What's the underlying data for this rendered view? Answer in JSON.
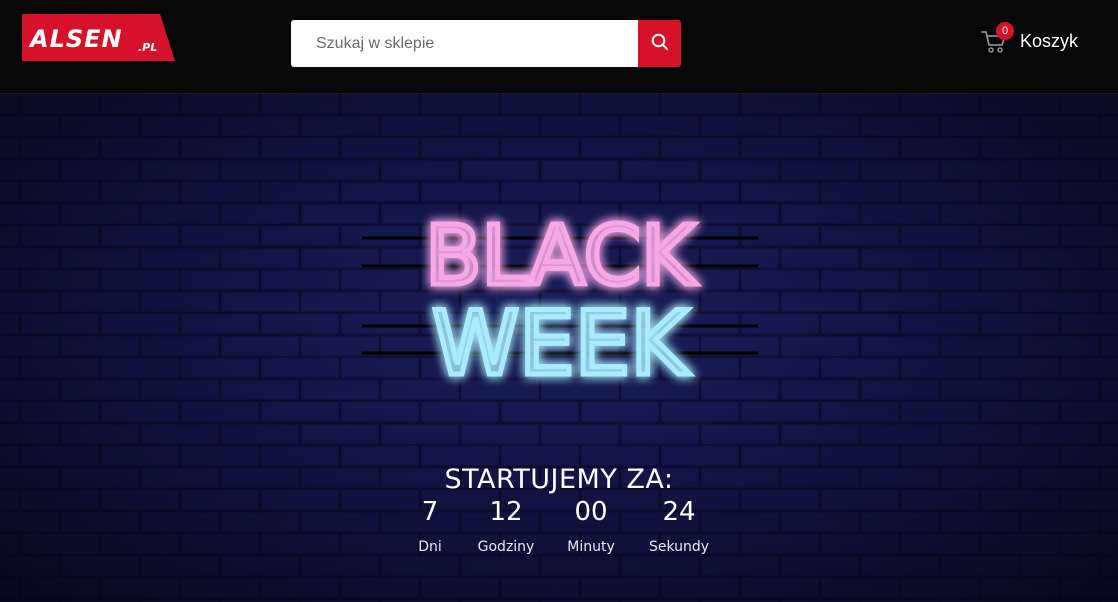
{
  "header": {
    "logo_text": "ALSEN.PL",
    "search_placeholder": "Szukaj w sklepie",
    "cart": {
      "count": "0",
      "label": "Koszyk"
    }
  },
  "icons": {
    "search": "search-icon",
    "cart": "cart-icon"
  },
  "colors": {
    "brand_red": "#d6122a",
    "topbar": "#070707",
    "neon_pink": "#f08ad6",
    "neon_blue": "#8fe6ff"
  },
  "hero": {
    "neon_line1": "BLACK",
    "neon_line2": "WEEK",
    "countdown_title": "STARTUJEMY ZA:",
    "countdown": [
      {
        "value": "7",
        "label": "Dni"
      },
      {
        "value": "12",
        "label": "Godziny"
      },
      {
        "value": "00",
        "label": "Minuty"
      },
      {
        "value": "24",
        "label": "Sekundy"
      }
    ]
  }
}
